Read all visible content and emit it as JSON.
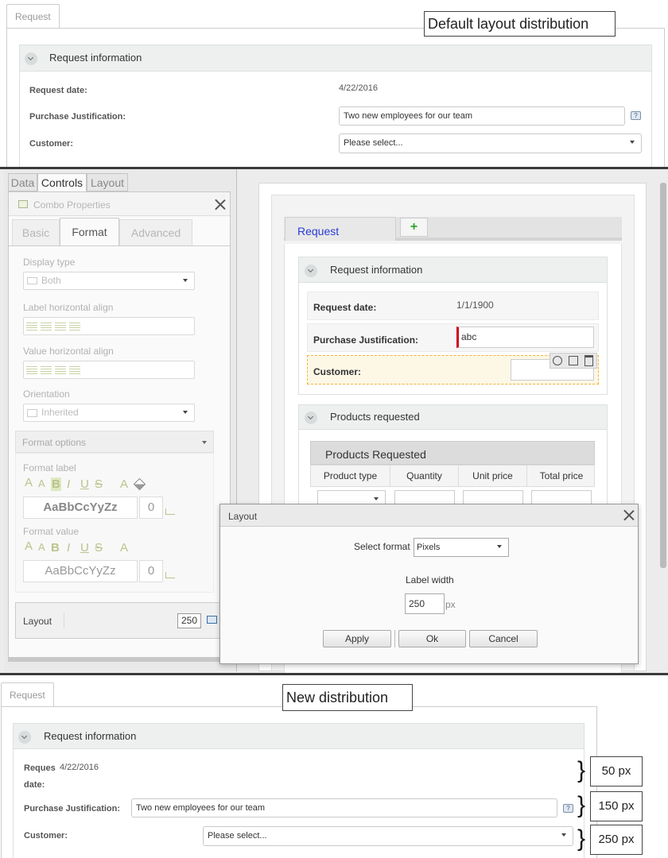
{
  "top": {
    "tab_label": "Request",
    "callout": "Default layout distribution",
    "group_title": "Request information",
    "fields": {
      "request_date_label": "Request date:",
      "request_date_value": "4/22/2016",
      "justification_label": "Purchase Justification:",
      "justification_value": "Two new employees for our team",
      "customer_label": "Customer:",
      "customer_value": "Please select..."
    },
    "help_glyph": "?"
  },
  "editor": {
    "top_tabs": [
      "Data",
      "Controls",
      "Layout"
    ],
    "combo_panel": {
      "title": "Combo Properties",
      "sub_tabs": [
        "Basic",
        "Format",
        "Advanced"
      ],
      "display_type_label": "Display type",
      "display_type_value": "Both",
      "label_halign_label": "Label horizontal align",
      "value_halign_label": "Value horizontal align",
      "orientation_label": "Orientation",
      "orientation_value": "Inherited",
      "format_options_label": "Format options",
      "format_label_label": "Format label",
      "format_value_label": "Format value",
      "sample_text": "AaBbCcYyZz",
      "sample_size": "0",
      "format_letters": [
        "A",
        "A",
        "B",
        "I",
        "U",
        "S",
        "A"
      ],
      "layout_label": "Layout",
      "layout_value": "250"
    },
    "form": {
      "tab_label": "Request",
      "add_glyph": "+",
      "group1_title": "Request information",
      "request_date_label": "Request date:",
      "request_date_value": "1/1/1900",
      "justification_label": "Purchase Justification:",
      "justification_value": "abc",
      "customer_label": "Customer:",
      "group2_title": "Products requested",
      "grid_title": "Products Requested",
      "columns": [
        "Product type",
        "Quantity",
        "Unit price",
        "Total price"
      ]
    },
    "dialog": {
      "title": "Layout",
      "select_format_label": "Select format",
      "select_format_value": "Pixels",
      "label_width_label": "Label width",
      "label_width_value": "250",
      "unit": "px",
      "buttons": [
        "Apply",
        "Ok",
        "Cancel"
      ]
    }
  },
  "bottom": {
    "tab_label": "Request",
    "callout": "New distribution",
    "group_title": "Request information",
    "request_label_part1": "Reques",
    "request_label_part2": "date:",
    "request_date_value": "4/22/2016",
    "justification_label": "Purchase Justification:",
    "justification_value": "Two new employees for our team",
    "customer_label": "Customer:",
    "customer_value": "Please select...",
    "annotations": [
      "50 px",
      "150 px",
      "250 px"
    ]
  }
}
